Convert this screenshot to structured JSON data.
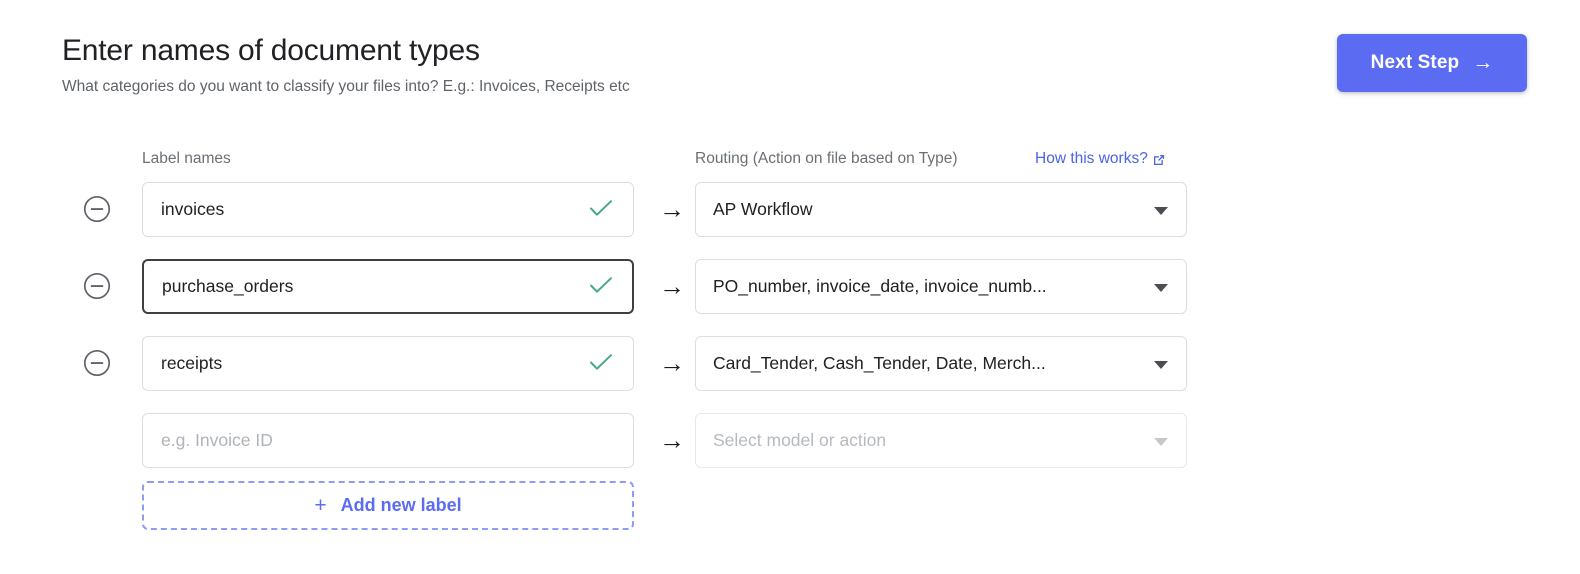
{
  "header": {
    "title": "Enter names of document types",
    "subtitle": "What categories do you want to classify your files into? E.g.: Invoices, Receipts etc",
    "next_step_label": "Next Step",
    "next_step_arrow": "→",
    "accent_color": "#5b6cf3"
  },
  "columns": {
    "label_names": "Label names",
    "routing": "Routing (Action on file based on Type)",
    "how_link": "How this works?"
  },
  "icons": {
    "remove": "minus-circle-icon",
    "valid": "check-icon",
    "flow_arrow": "→",
    "external_link": "external-link-icon",
    "dropdown": "chevron-down-icon",
    "plus": "+"
  },
  "colors": {
    "check": "#4aa884",
    "link": "#4a62e8",
    "remove_icon": "#5f6368",
    "dashed_border": "#8e9cf6"
  },
  "rows": [
    {
      "label_value": "invoices",
      "label_placeholder": "",
      "valid": true,
      "focused": false,
      "routing_value": "AP Workflow",
      "routing_disabled": false,
      "removable": true
    },
    {
      "label_value": "purchase_orders",
      "label_placeholder": "",
      "valid": true,
      "focused": true,
      "routing_value": "PO_number, invoice_date, invoice_numb...",
      "routing_disabled": false,
      "removable": true
    },
    {
      "label_value": "receipts",
      "label_placeholder": "",
      "valid": true,
      "focused": false,
      "routing_value": "Card_Tender, Cash_Tender, Date, Merch...",
      "routing_disabled": false,
      "removable": true
    },
    {
      "label_value": "",
      "label_placeholder": "e.g. Invoice ID",
      "valid": false,
      "focused": false,
      "routing_value": "Select model or action",
      "routing_disabled": true,
      "removable": false
    }
  ],
  "add_label": {
    "label": "Add new label"
  }
}
